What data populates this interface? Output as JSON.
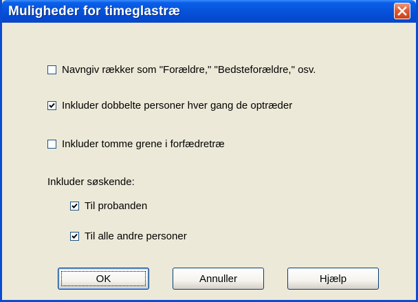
{
  "window": {
    "title": "Muligheder for timeglastræ"
  },
  "options": [
    {
      "label": "Navngiv rækker som \"Forældre,\" \"Bedsteforældre,\" osv.",
      "checked": false
    },
    {
      "label": "Inkluder dobbelte personer hver gang de optræder",
      "checked": true
    },
    {
      "label": "Inkluder tomme grene i forfædretræ",
      "checked": false
    }
  ],
  "siblings": {
    "heading": "Inkluder søskende:",
    "options": [
      {
        "label": "Til probanden",
        "checked": true
      },
      {
        "label": "Til alle andre personer",
        "checked": true
      }
    ]
  },
  "buttons": {
    "ok": "OK",
    "cancel": "Annuller",
    "help": "Hjælp"
  },
  "colors": {
    "titlebar": "#0754DB",
    "dialog_bg": "#ECE9D8",
    "close_button": "#E05B35"
  }
}
